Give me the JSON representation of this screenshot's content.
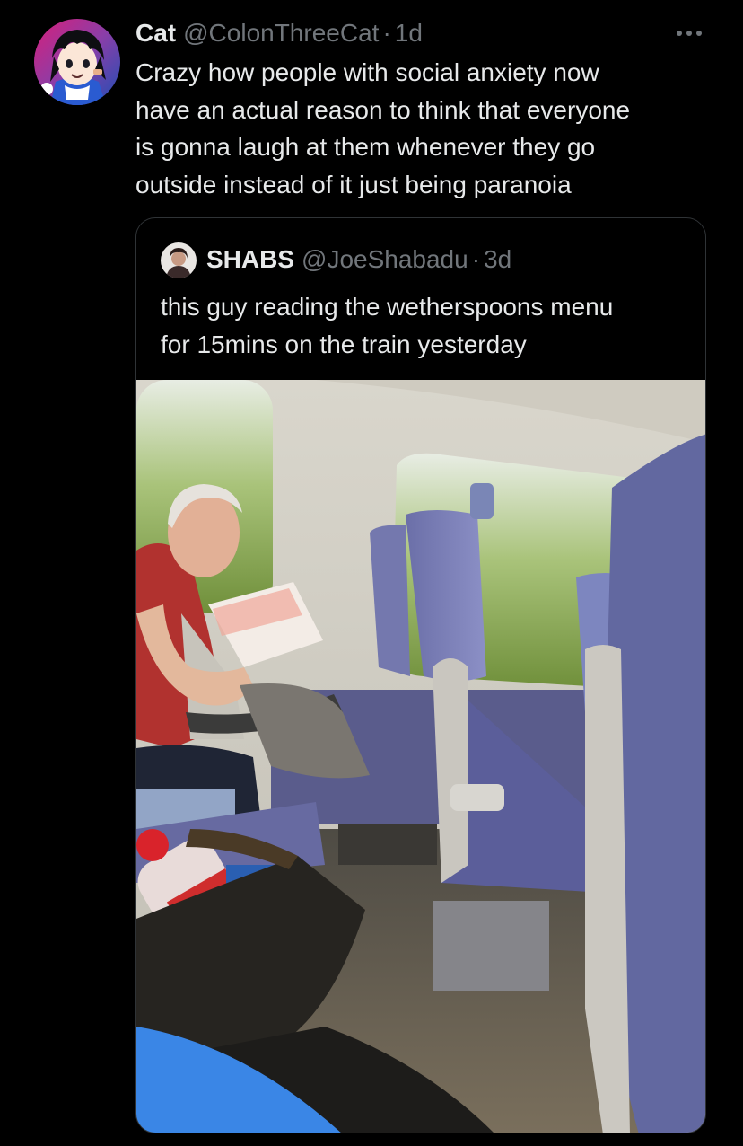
{
  "tweet": {
    "display_name": "Cat",
    "handle": "@ColonThreeCat",
    "separator": "·",
    "time": "1d",
    "text": "Crazy how people with social anxiety now\nhave an actual reason to think that everyone\nis gonna laugh at them whenever they go\noutside instead of it just being paranoia",
    "avatar_icon": "anime-character-avatar",
    "more_icon": "more-horizontal-icon"
  },
  "quote": {
    "display_name": "SHABS",
    "handle": "@JoeShabadu",
    "separator": "·",
    "time": "3d",
    "text": "this guy reading the wetherspoons menu\nfor 15mins on the train yesterday",
    "avatar_icon": "user-avatar-photo",
    "media": "train-interior-photo"
  },
  "colors": {
    "background": "#000000",
    "primary_text": "#e7e9ea",
    "secondary_text": "#71767b",
    "border": "#2f3336"
  }
}
